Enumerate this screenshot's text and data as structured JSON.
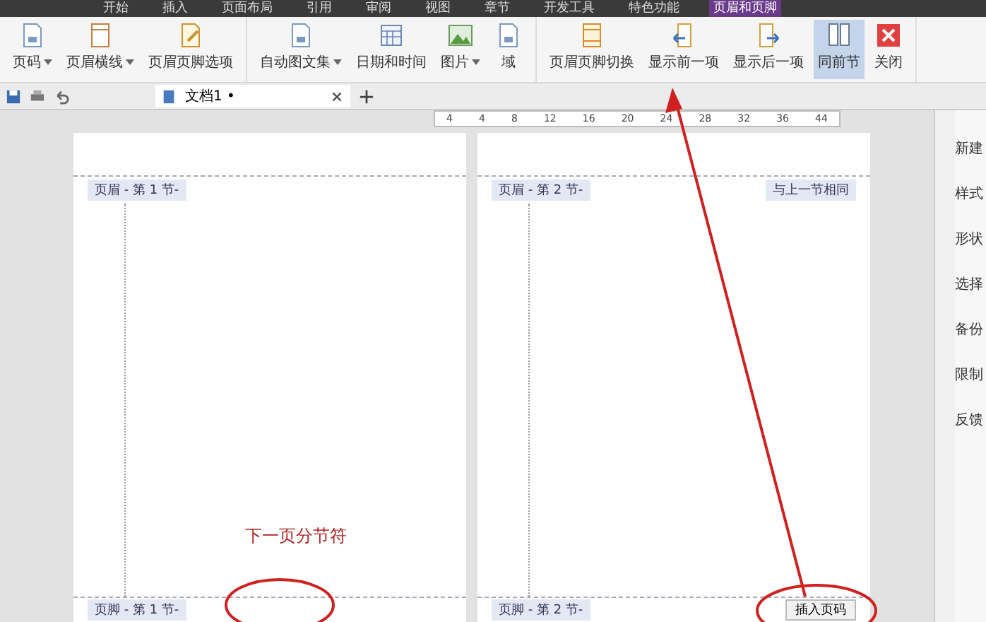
{
  "menu_tabs": [
    {
      "label": "开始",
      "selected": false
    },
    {
      "label": "插入",
      "selected": false
    },
    {
      "label": "页面布局",
      "selected": false
    },
    {
      "label": "引用",
      "selected": false
    },
    {
      "label": "审阅",
      "selected": false
    },
    {
      "label": "视图",
      "selected": false
    },
    {
      "label": "章节",
      "selected": false
    },
    {
      "label": "开发工具",
      "selected": false
    },
    {
      "label": "特色功能",
      "selected": false
    },
    {
      "label": "页眉和页脚",
      "selected": true
    }
  ],
  "ribbon_groups": [
    {
      "buttons": [
        {
          "label": "页码",
          "dropdown": true,
          "selected": false
        },
        {
          "label": "页眉横线",
          "dropdown": true,
          "selected": false
        },
        {
          "label": "页眉页脚选项",
          "dropdown": false,
          "selected": false
        }
      ]
    },
    {
      "buttons": [
        {
          "label": "自动图文集",
          "dropdown": true,
          "selected": false
        },
        {
          "label": "日期和时间",
          "dropdown": false,
          "selected": false
        },
        {
          "label": "图片",
          "dropdown": true,
          "selected": false
        },
        {
          "label": "域",
          "dropdown": false,
          "selected": false
        }
      ]
    },
    {
      "buttons": [
        {
          "label": "页眉页脚切换",
          "dropdown": false,
          "selected": false
        },
        {
          "label": "显示前一项",
          "dropdown": false,
          "selected": false
        },
        {
          "label": "显示后一项",
          "dropdown": false,
          "selected": false
        },
        {
          "label": "同前节",
          "dropdown": false,
          "selected": true
        },
        {
          "label": "关闭",
          "dropdown": false,
          "selected": false
        }
      ]
    }
  ],
  "document_tab": {
    "title": "文档1 •"
  },
  "ruler": {
    "ticks": [
      "4",
      "4",
      "8",
      "12",
      "16",
      "20",
      "24",
      "28",
      "32",
      "36",
      "44"
    ]
  },
  "pages": [
    {
      "header_label": "页眉 - 第 1 节-",
      "footer_label": "页脚 - 第 1 节-",
      "section_break": "下一页分节符"
    },
    {
      "header_label": "页眉 - 第 2 节-",
      "same_as_previous": "与上一节相同",
      "footer_label": "页脚 - 第 2 节-"
    }
  ],
  "insert_page_number": "插入页码",
  "side_panel": [
    "新建",
    "样式",
    "形状",
    "选择",
    "备份",
    "限制",
    "反馈"
  ]
}
